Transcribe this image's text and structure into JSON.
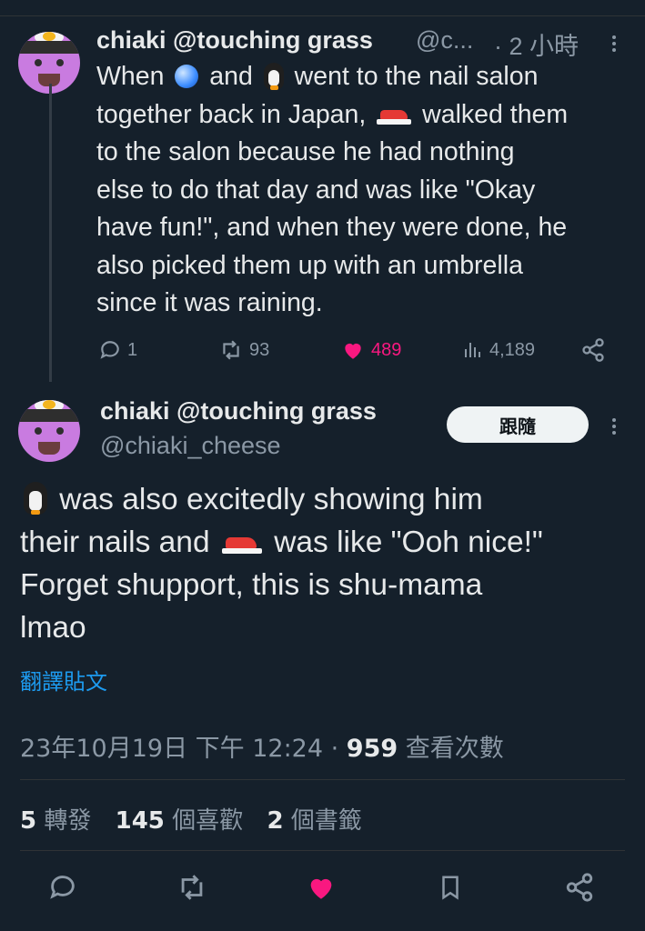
{
  "tweet1": {
    "display_name": "chiaki @touching grass",
    "handle": "@c...",
    "time": "· 2 小時",
    "lines": [
      {
        "a": "When ",
        "e1": "crystal-ball",
        "b": " and ",
        "e2": "penguin",
        "c": " went to the nail salon"
      },
      {
        "a": "together back in Japan, ",
        "e1": "sneaker",
        "b": " walked them"
      },
      {
        "a": "to the salon because he had nothing"
      },
      {
        "a": "else to do that day and was like \"Okay"
      },
      {
        "a": "have fun!\", and when they were done, he"
      },
      {
        "a": "also picked them up with an umbrella"
      },
      {
        "a": "since it was raining."
      }
    ],
    "replies": "1",
    "retweets": "93",
    "likes": "489",
    "views": "4,189"
  },
  "tweet2": {
    "display_name": "chiaki @touching grass",
    "handle": "@chiaki_cheese",
    "follow_label": "跟隨",
    "lines": [
      {
        "e1": "penguin",
        "a": " was also excitedly showing him"
      },
      {
        "a": "their nails and ",
        "e1": "sneaker",
        "b": " was like \"Ooh nice!\""
      },
      {
        "a": "Forget shupport, this is shu-mama"
      },
      {
        "a": "lmao"
      }
    ],
    "translate": "翻譯貼文",
    "date": "23年10月19日 下午 12:24 · ",
    "views_count": "959",
    "views_label": " 查看次數",
    "retweet_count": "5",
    "retweet_label": " 轉發",
    "like_count": "145",
    "like_label": " 個喜歡",
    "bookmark_count": "2",
    "bookmark_label": " 個書籤"
  },
  "colors": {
    "background": "#15202b",
    "like": "#f91880",
    "link": "#1d9bf0",
    "muted": "#8b98a5"
  }
}
